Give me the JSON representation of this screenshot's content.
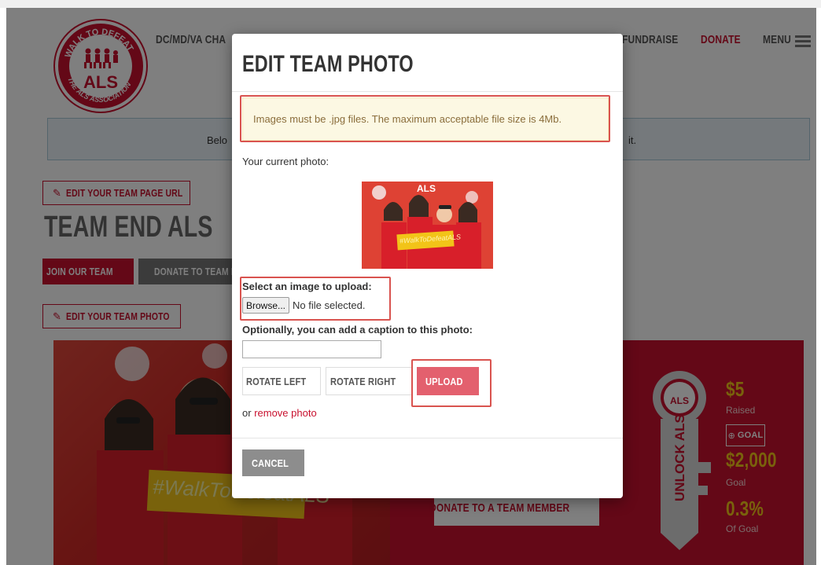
{
  "header": {
    "org_name": "DC/MD/VA CHA",
    "nav_fundraise": "FUNDRAISE",
    "nav_donate": "DONATE",
    "nav_menu": "MENU",
    "logo_text": "ALS",
    "logo_ring_top": "WALK TO DEFEAT",
    "logo_ring_bottom": "THE ALS ASSOCIATION"
  },
  "banner": {
    "left_text": "Belo",
    "right_text": "it."
  },
  "page": {
    "edit_url_button": "EDIT YOUR TEAM PAGE URL",
    "team_name": "TEAM END ALS",
    "join_button": "JOIN OUR TEAM",
    "donate_team_button": "DONATE TO TEAM M",
    "edit_photo_button": "EDIT YOUR TEAM PHOTO",
    "photo_sign": "#WalkToDefeatALS",
    "donate_member_button": "DONATE TO A TEAM MEMBER",
    "key_text": "UNLOCK ALS",
    "raised_amount": "$5",
    "raised_label": "Raised",
    "goal_button": "GOAL",
    "goal_amount": "$2,000",
    "goal_label": "Goal",
    "percent": "0.3%",
    "percent_label": "Of Goal"
  },
  "modal": {
    "title": "EDIT TEAM PHOTO",
    "alert": "Images must be .jpg files. The maximum acceptable file size is 4Mb.",
    "current_photo_label": "Your current photo:",
    "select_label": "Select an image to upload:",
    "browse_button": "Browse...",
    "no_file": "No file selected.",
    "caption_label": "Optionally, you can add a caption to this photo:",
    "caption_value": "",
    "rotate_left": "ROTATE LEFT",
    "rotate_right": "ROTATE RIGHT",
    "upload": "UPLOAD",
    "or_text": "or",
    "remove_photo": "remove photo",
    "cancel": "CANCEL",
    "thumb_sign": "#WalkToDefeatALS",
    "thumb_badge": "ALS"
  },
  "colors": {
    "brand_red": "#c8102e",
    "upload_pink": "#e3606e",
    "highlight_red": "#d9534f",
    "alert_bg": "#fcf8e3",
    "stat_yellow": "#f2c418"
  },
  "icons": [
    "pencil-icon",
    "menu-icon",
    "plus-circle-icon",
    "key-icon",
    "logo-walkers-icon"
  ]
}
